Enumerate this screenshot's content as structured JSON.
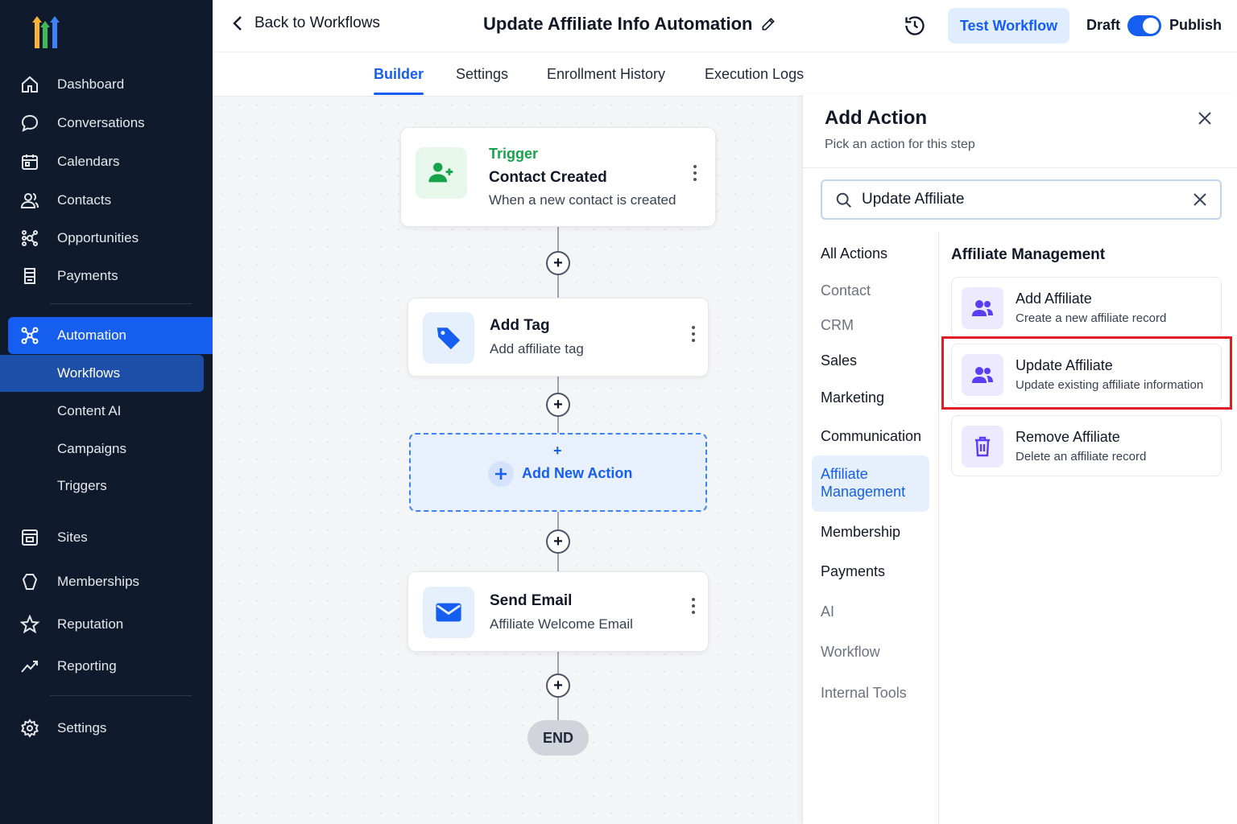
{
  "sidebar": {
    "items": [
      {
        "label": "Dashboard",
        "icon": "home-icon"
      },
      {
        "label": "Conversations",
        "icon": "chat-icon"
      },
      {
        "label": "Calendars",
        "icon": "calendar-icon"
      },
      {
        "label": "Contacts",
        "icon": "contacts-icon"
      },
      {
        "label": "Opportunities",
        "icon": "opportunities-icon"
      },
      {
        "label": "Payments",
        "icon": "payments-icon"
      },
      {
        "label": "Automation",
        "icon": "automation-icon"
      },
      {
        "label": "Workflows"
      },
      {
        "label": "Content AI"
      },
      {
        "label": "Campaigns"
      },
      {
        "label": "Triggers"
      },
      {
        "label": "Sites",
        "icon": "sites-icon"
      },
      {
        "label": "Memberships",
        "icon": "memberships-icon"
      },
      {
        "label": "Reputation",
        "icon": "star-icon"
      },
      {
        "label": "Reporting",
        "icon": "trend-icon"
      },
      {
        "label": "Settings",
        "icon": "gear-icon"
      }
    ]
  },
  "header": {
    "back_label": "Back to Workflows",
    "title": "Update Affiliate Info Automation",
    "test_button": "Test Workflow",
    "draft_label": "Draft",
    "publish_label": "Publish",
    "publish_toggle_on": true
  },
  "tabs": [
    {
      "label": "Builder",
      "active": true
    },
    {
      "label": "Settings"
    },
    {
      "label": "Enrollment History"
    },
    {
      "label": "Execution Logs"
    }
  ],
  "workflow": {
    "trigger": {
      "kind": "Trigger",
      "title": "Contact Created",
      "desc": "When a new contact is created"
    },
    "step1": {
      "title": "Add Tag",
      "desc": "Add affiliate tag"
    },
    "add_new": {
      "plus": "+",
      "label": "Add New Action"
    },
    "step2": {
      "title": "Send Email",
      "desc": "Affiliate Welcome Email"
    },
    "end_label": "END"
  },
  "panel": {
    "title": "Add Action",
    "subtitle": "Pick an action for this step",
    "search_value": "Update Affiliate",
    "categories": [
      "All Actions",
      "Contact",
      "CRM",
      "Sales",
      "Marketing",
      "Communication",
      "Affiliate Management",
      "Membership",
      "Payments",
      "AI",
      "Workflow",
      "Internal Tools"
    ],
    "active_category": "Affiliate Management",
    "section_heading": "Affiliate Management",
    "actions": [
      {
        "title": "Add Affiliate",
        "desc": "Create a new affiliate record",
        "icon": "users-icon"
      },
      {
        "title": "Update Affiliate",
        "desc": "Update existing affiliate information",
        "icon": "users-icon",
        "highlighted": true
      },
      {
        "title": "Remove Affiliate",
        "desc": "Delete an affiliate record",
        "icon": "trash-icon"
      }
    ]
  },
  "colors": {
    "accent": "#155eef",
    "sidebar_bg": "#0f1b2d",
    "trigger_green": "#16a34a",
    "affiliate_purple": "#5b3df5",
    "highlight_red": "#e11d24"
  }
}
